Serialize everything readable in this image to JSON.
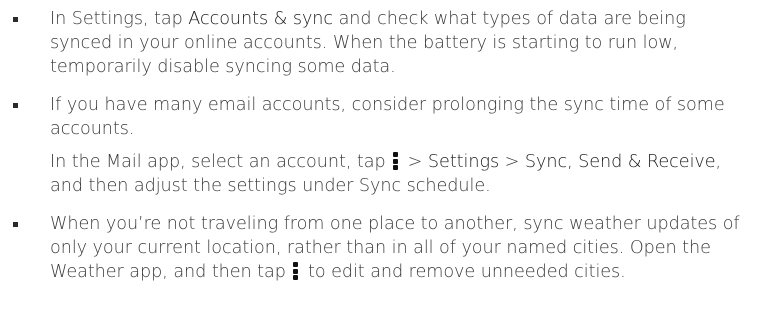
{
  "bullets": [
    {
      "a": "In Settings, tap ",
      "b": "Accounts & sync",
      "c": " and check what types of data are being synced in your online accounts. When the battery is starting to run low, temporarily disable syncing some data."
    },
    {
      "p1": "If you have many email accounts, consider prolonging the sync time of some accounts.",
      "p2a": "In the Mail app, select an account, tap ",
      "p2b": " > ",
      "p2c": "Settings",
      "p2d": " > ",
      "p2e": "Sync, Send & Receive",
      "p2f": ", and then adjust the settings under Sync schedule."
    },
    {
      "a": "When you’re not traveling from one place to another, sync weather updates of only your current location, rather than in all of your named cities. Open the Weather app, and then tap ",
      "b": " to edit and remove unneeded cities."
    }
  ],
  "icons": {
    "menu": "more-vertical-icon"
  }
}
